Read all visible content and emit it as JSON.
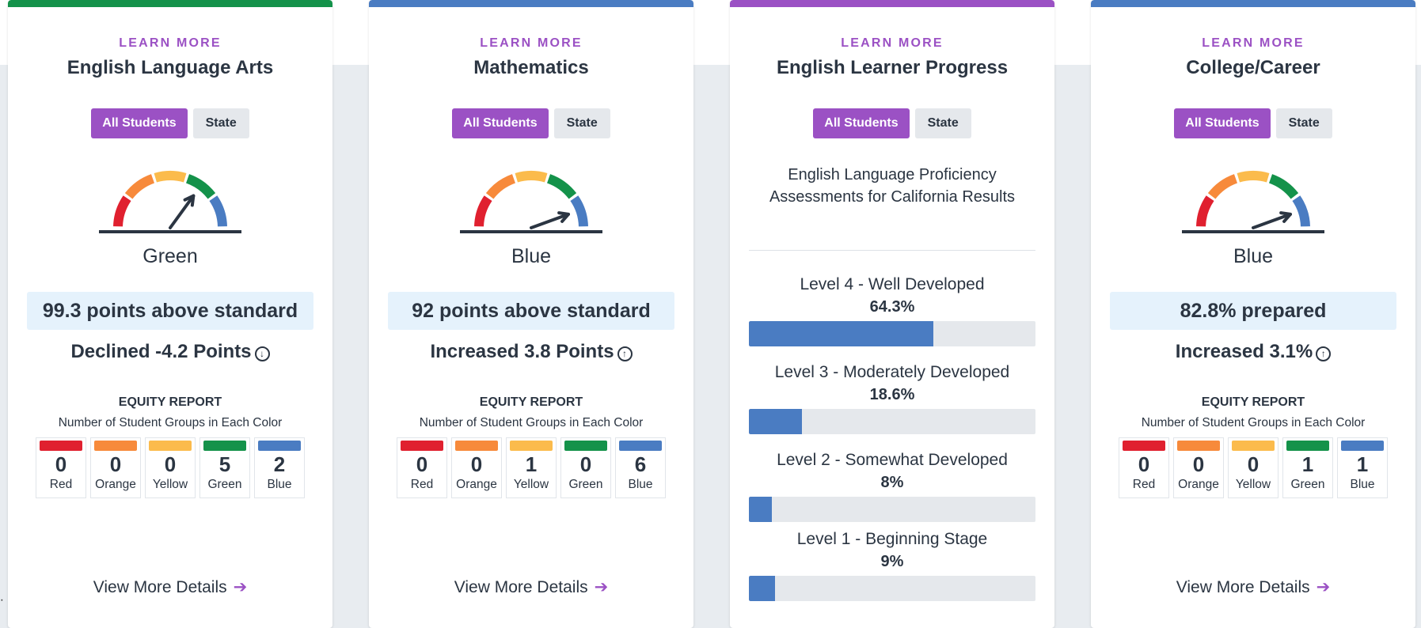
{
  "cards": [
    {
      "learn_more": "LEARN MORE",
      "title": "English Language Arts",
      "toggle": {
        "active": "All Students",
        "inactive": "State"
      },
      "gauge_level": "green",
      "color_label": "Green",
      "status": "99.3 points above standard",
      "change_text": "Declined -4.2 Points",
      "change_direction": "down",
      "equity": {
        "title": "EQUITY REPORT",
        "subtitle": "Number of Student Groups in Each Color",
        "cells": [
          {
            "count": "0",
            "label": "Red"
          },
          {
            "count": "0",
            "label": "Orange"
          },
          {
            "count": "0",
            "label": "Yellow"
          },
          {
            "count": "5",
            "label": "Green"
          },
          {
            "count": "2",
            "label": "Blue"
          }
        ]
      },
      "view_more": "View More Details"
    },
    {
      "learn_more": "LEARN MORE",
      "title": "Mathematics",
      "toggle": {
        "active": "All Students",
        "inactive": "State"
      },
      "gauge_level": "blue",
      "color_label": "Blue",
      "status": "92 points above standard",
      "change_text": "Increased 3.8 Points",
      "change_direction": "up",
      "equity": {
        "title": "EQUITY REPORT",
        "subtitle": "Number of Student Groups in Each Color",
        "cells": [
          {
            "count": "0",
            "label": "Red"
          },
          {
            "count": "0",
            "label": "Orange"
          },
          {
            "count": "1",
            "label": "Yellow"
          },
          {
            "count": "0",
            "label": "Green"
          },
          {
            "count": "6",
            "label": "Blue"
          }
        ]
      },
      "view_more": "View More Details"
    },
    {
      "learn_more": "LEARN MORE",
      "title": "English Learner Progress",
      "toggle": {
        "active": "All Students",
        "inactive": "State"
      },
      "description": "English Language Proficiency Assessments for California Results",
      "levels": [
        {
          "name": "Level 4 - Well Developed",
          "value": "64.3%",
          "percent": 64.3
        },
        {
          "name": "Level 3 - Moderately Developed",
          "value": "18.6%",
          "percent": 18.6
        },
        {
          "name": "Level 2 - Somewhat Developed",
          "value": "8%",
          "percent": 8
        },
        {
          "name": "Level 1 - Beginning Stage",
          "value": "9%",
          "percent": 9
        }
      ]
    },
    {
      "learn_more": "LEARN MORE",
      "title": "College/Career",
      "toggle": {
        "active": "All Students",
        "inactive": "State"
      },
      "gauge_level": "blue",
      "color_label": "Blue",
      "status": "82.8% prepared",
      "change_text": "Increased 3.1%",
      "change_direction": "up",
      "equity": {
        "title": "EQUITY REPORT",
        "subtitle": "Number of Student Groups in Each Color",
        "cells": [
          {
            "count": "0",
            "label": "Red"
          },
          {
            "count": "0",
            "label": "Orange"
          },
          {
            "count": "0",
            "label": "Yellow"
          },
          {
            "count": "1",
            "label": "Green"
          },
          {
            "count": "1",
            "label": "Blue"
          }
        ]
      },
      "view_more": "View More Details"
    }
  ],
  "colors": {
    "accent_purple": "#9b51c4",
    "red": "#e0202f",
    "orange": "#f78a3b",
    "yellow": "#fbbb4c",
    "green": "#14924a",
    "blue": "#4a7cc2",
    "topbar_ela": "#14924a",
    "topbar_math": "#4a7cc2",
    "topbar_elp": "#9b51c4",
    "topbar_cc": "#4a7cc2"
  },
  "icons": {
    "change_down": "circle-arrow-down-icon",
    "change_up": "circle-arrow-up-icon",
    "view_more": "arrow-right-icon"
  }
}
